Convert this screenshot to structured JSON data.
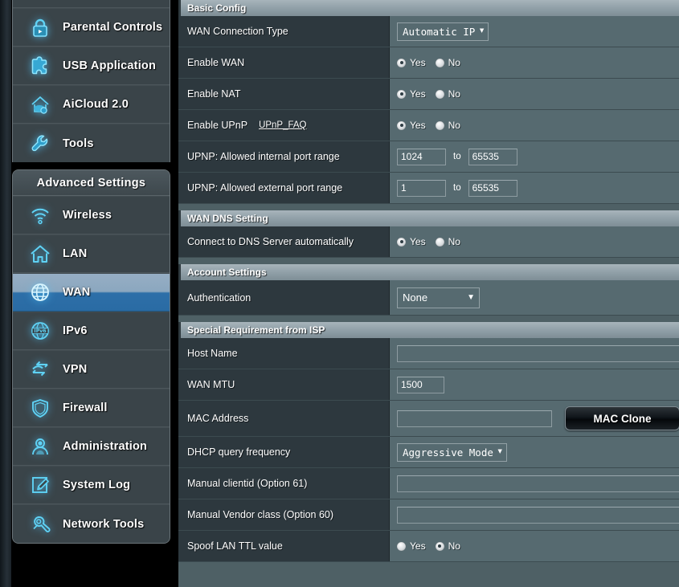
{
  "sidebar": {
    "top_items": [
      {
        "label": "Parental Controls",
        "icon": "lock-icon"
      },
      {
        "label": "USB Application",
        "icon": "puzzle-icon"
      },
      {
        "label": "AiCloud 2.0",
        "icon": "cloud-house-icon"
      },
      {
        "label": "Tools",
        "icon": "wrench-icon"
      }
    ],
    "advanced_header": "Advanced Settings",
    "advanced_items": [
      {
        "label": "Wireless",
        "icon": "wifi-icon",
        "active": false
      },
      {
        "label": "LAN",
        "icon": "house-icon",
        "active": false
      },
      {
        "label": "WAN",
        "icon": "globe-icon",
        "active": true
      },
      {
        "label": "IPv6",
        "icon": "ipv6-globe-icon",
        "active": false
      },
      {
        "label": "VPN",
        "icon": "vpn-arrows-icon",
        "active": false
      },
      {
        "label": "Firewall",
        "icon": "shield-icon",
        "active": false
      },
      {
        "label": "Administration",
        "icon": "user-icon",
        "active": false
      },
      {
        "label": "System Log",
        "icon": "pencil-note-icon",
        "active": false
      },
      {
        "label": "Network Tools",
        "icon": "wrench-network-icon",
        "active": false
      }
    ]
  },
  "sections": {
    "basic_config": {
      "title": "Basic Config",
      "wan_connection_type": {
        "label": "WAN Connection Type",
        "value": "Automatic IP"
      },
      "enable_wan": {
        "label": "Enable WAN",
        "yes": "Yes",
        "no": "No",
        "selected": "Yes"
      },
      "enable_nat": {
        "label": "Enable NAT",
        "yes": "Yes",
        "no": "No",
        "selected": "Yes"
      },
      "enable_upnp": {
        "label": "Enable UPnP",
        "faq_link": "UPnP_FAQ",
        "yes": "Yes",
        "no": "No",
        "selected": "Yes"
      },
      "upnp_internal": {
        "label": "UPNP: Allowed internal port range",
        "from": "1024",
        "to_text": "to",
        "to": "65535"
      },
      "upnp_external": {
        "label": "UPNP: Allowed external port range",
        "from": "1",
        "to_text": "to",
        "to": "65535"
      }
    },
    "wan_dns": {
      "title": "WAN DNS Setting",
      "connect_auto": {
        "label": "Connect to DNS Server automatically",
        "yes": "Yes",
        "no": "No",
        "selected": "Yes"
      }
    },
    "account_settings": {
      "title": "Account Settings",
      "authentication": {
        "label": "Authentication",
        "value": "None"
      }
    },
    "special_isp": {
      "title": "Special Requirement from ISP",
      "host_name": {
        "label": "Host Name",
        "value": ""
      },
      "wan_mtu": {
        "label": "WAN MTU",
        "value": "1500"
      },
      "mac_address": {
        "label": "MAC Address",
        "value": "",
        "button": "MAC Clone"
      },
      "dhcp_query": {
        "label": "DHCP query frequency",
        "value": "Aggressive Mode"
      },
      "manual_clientid": {
        "label": "Manual clientid (Option 61)",
        "value": ""
      },
      "manual_vendor": {
        "label": "Manual Vendor class (Option 60)",
        "value": ""
      },
      "spoof_ttl": {
        "label": "Spoof LAN TTL value",
        "yes": "Yes",
        "no": "No",
        "selected": "No"
      }
    }
  },
  "colors": {
    "accent_blue": "#2a6ba4",
    "icon_cyan": "#5fd2f5",
    "label_bg": "#2d383e",
    "value_bg": "#566a70",
    "section_head": "#93a2aa"
  }
}
